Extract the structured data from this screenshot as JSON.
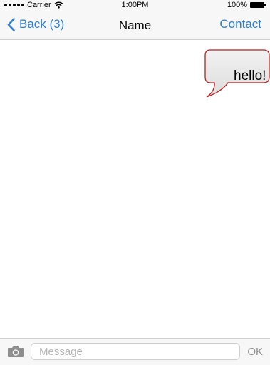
{
  "status_bar": {
    "carrier": "Carrier",
    "time": "1:00PM",
    "battery": "100%"
  },
  "nav": {
    "back_label": "Back (3)",
    "title": "Name",
    "contact_label": "Contact"
  },
  "messages": [
    {
      "text": "hello!",
      "side": "right"
    }
  ],
  "input": {
    "placeholder": "Message",
    "value": "",
    "send_label": "OK"
  },
  "colors": {
    "accent": "#2e7fd1",
    "bubble_fill": "#e8e8e8",
    "bubble_border": "#b22222",
    "bar_background": "#f7f7f7"
  },
  "icons": [
    "signal-icon",
    "wifi-icon",
    "battery-icon",
    "chevron-left-icon",
    "camera-icon"
  ]
}
